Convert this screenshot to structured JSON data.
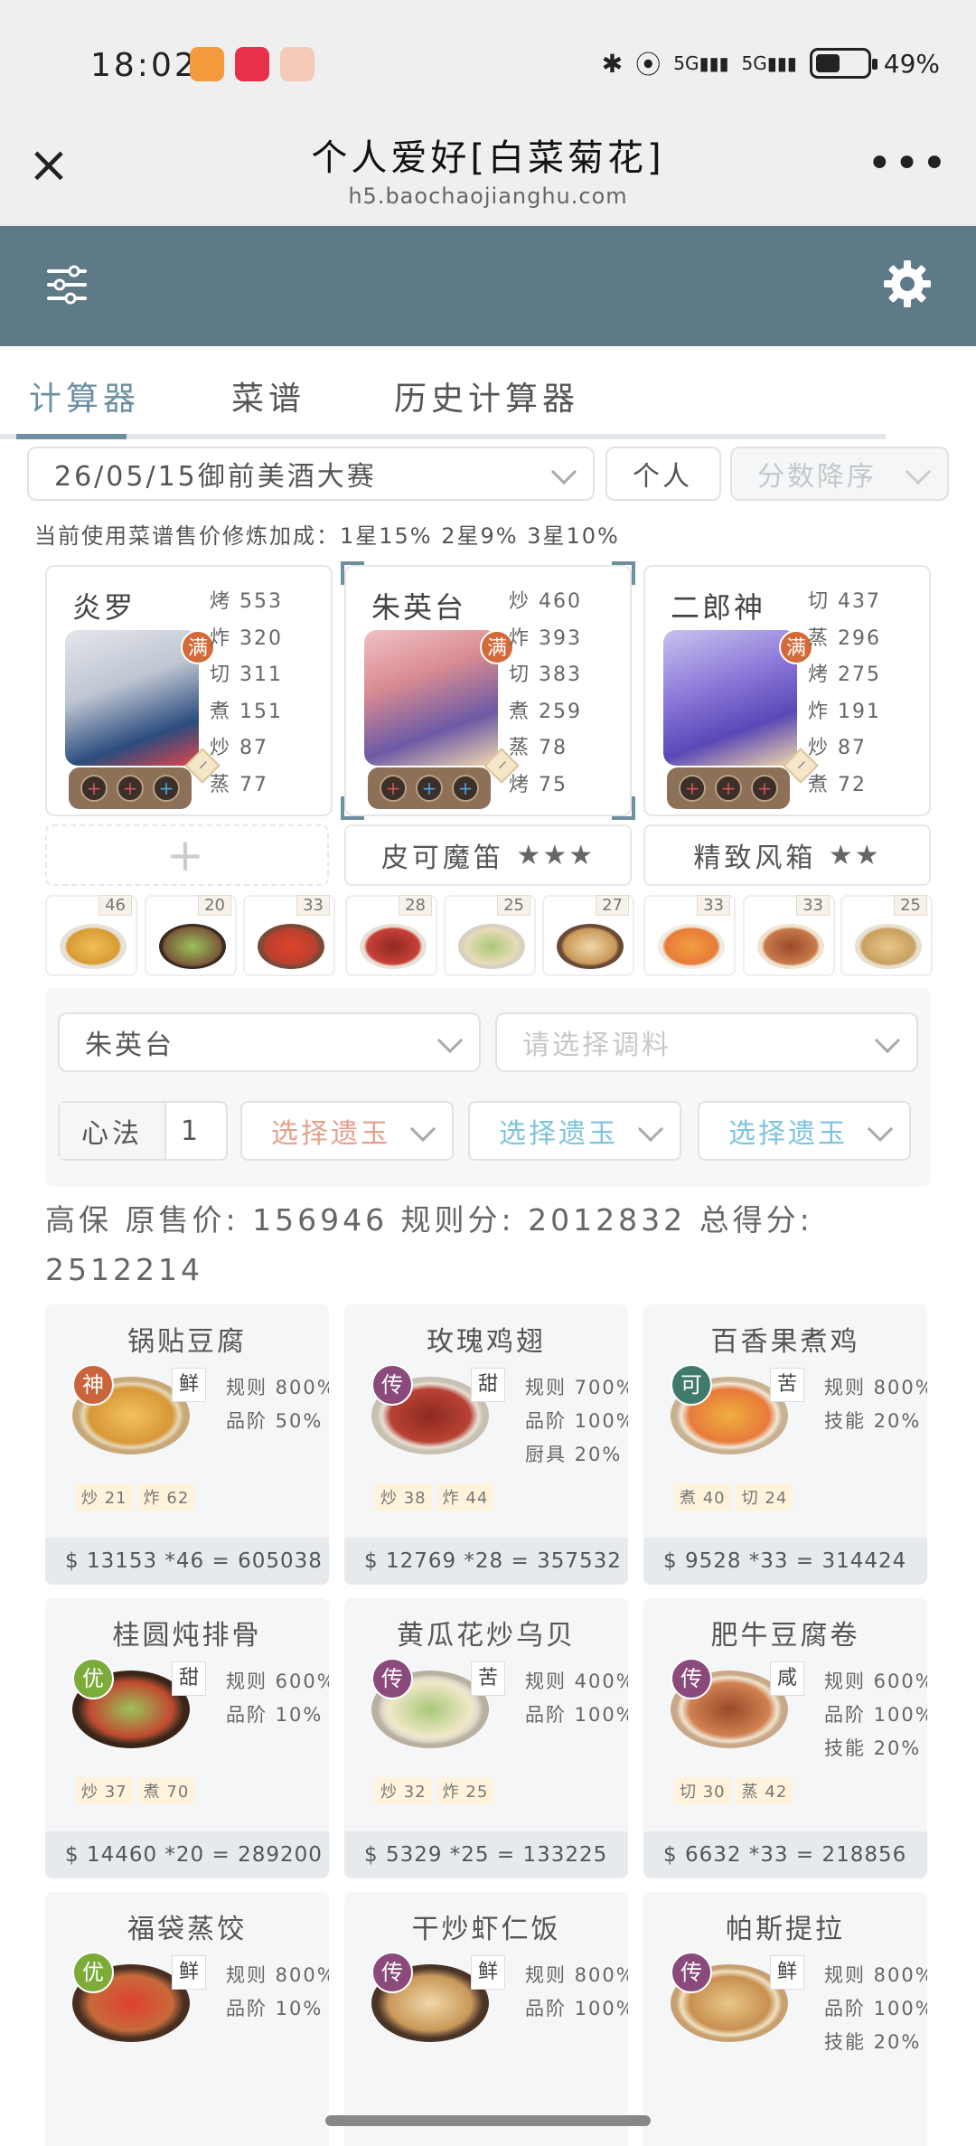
{
  "status_bar": {
    "time": "18:02",
    "battery": "49%",
    "net1": "5G",
    "net2": "5G"
  },
  "browser": {
    "title": "个人爱好[白菜菊花]",
    "url": "h5.baochaojianghu.com",
    "close_icon": "close-icon",
    "more_icon": "more-icon"
  },
  "appbar": {
    "menu_icon": "sliders-icon",
    "settings_icon": "gear-icon",
    "color": "#5e7a87"
  },
  "tabs": [
    {
      "label": "计算器",
      "active": true
    },
    {
      "label": "菜谱",
      "active": false
    },
    {
      "label": "历史计算器",
      "active": false
    }
  ],
  "filters": {
    "contest": "26/05/15御前美酒大赛",
    "mode": "个人",
    "sort": "分数降序"
  },
  "bonus_text": "当前使用菜谱售价修炼加成：1星15% 2星9% 3星10%",
  "chefs": [
    {
      "name": "炎罗",
      "stats": [
        "烤 553",
        "炸 320",
        "切 311",
        "煮 151",
        "炒 87",
        "蒸 77"
      ],
      "badge": "满",
      "slots": [
        "+",
        "+",
        "+"
      ]
    },
    {
      "name": "朱英台",
      "stats": [
        "炒 460",
        "炸 393",
        "切 383",
        "煮 259",
        "蒸 78",
        "烤 75"
      ],
      "badge": "满",
      "slots": [
        "+",
        "+",
        "+"
      ]
    },
    {
      "name": "二郎神",
      "stats": [
        "切 437",
        "蒸 296",
        "烤 275",
        "炸 191",
        "炒 87",
        "煮 72"
      ],
      "badge": "满",
      "slots": [
        "+",
        "+",
        "+"
      ]
    }
  ],
  "equips": [
    {
      "label": "",
      "stars": "",
      "empty": true
    },
    {
      "label": "皮可魔笛",
      "stars": "★★★"
    },
    {
      "label": "精致风箱",
      "stars": "★★"
    }
  ],
  "dishes": [
    {
      "count": "46"
    },
    {
      "count": "20"
    },
    {
      "count": "33"
    },
    {
      "count": "28"
    },
    {
      "count": "25"
    },
    {
      "count": "27"
    },
    {
      "count": "33"
    },
    {
      "count": "33"
    },
    {
      "count": "25"
    }
  ],
  "config": {
    "chef_select": "朱英台",
    "seasoning_placeholder": "请选择调料",
    "heart_label": "心法",
    "heart_value": "1",
    "gems": [
      {
        "label": "选择遗玉",
        "color": "#e8a08c"
      },
      {
        "label": "选择遗玉",
        "color": "#7ec4dc"
      },
      {
        "label": "选择遗玉",
        "color": "#7ec4dc"
      }
    ]
  },
  "summary": "高保 原售价: 156946 规则分: 2012832 总得分: 2512214",
  "recipes": [
    {
      "name": "锅贴豆腐",
      "badge": "神",
      "badge_color": "#c9653c",
      "flavor": "鲜",
      "rules": [
        "规则 800%",
        "品阶 50%"
      ],
      "skills": [
        "炒 21",
        "炸 62"
      ],
      "total": "$ 13153 *46 = 605038"
    },
    {
      "name": "玫瑰鸡翅",
      "badge": "传",
      "badge_color": "#8b4a7c",
      "flavor": "甜",
      "rules": [
        "规则 700%",
        "品阶 100%",
        "厨具 20%"
      ],
      "skills": [
        "炒 38",
        "炸 44"
      ],
      "total": "$ 12769 *28 = 357532"
    },
    {
      "name": "百香果煮鸡",
      "badge": "可",
      "badge_color": "#3f7a6c",
      "flavor": "苦",
      "rules": [
        "规则 800%",
        "技能 20%"
      ],
      "skills": [
        "煮 40",
        "切 24"
      ],
      "total": "$ 9528 *33 = 314424"
    },
    {
      "name": "桂圆炖排骨",
      "badge": "优",
      "badge_color": "#7cab3a",
      "flavor": "甜",
      "rules": [
        "规则 600%",
        "品阶 10%"
      ],
      "skills": [
        "炒 37",
        "煮 70"
      ],
      "total": "$ 14460 *20 = 289200"
    },
    {
      "name": "黄瓜花炒乌贝",
      "badge": "传",
      "badge_color": "#8b4a7c",
      "flavor": "苦",
      "rules": [
        "规则 400%",
        "品阶 100%"
      ],
      "skills": [
        "炒 32",
        "炸 25"
      ],
      "total": "$ 5329 *25 = 133225"
    },
    {
      "name": "肥牛豆腐卷",
      "badge": "传",
      "badge_color": "#8b4a7c",
      "flavor": "咸",
      "rules": [
        "规则 600%",
        "品阶 100%",
        "技能 20%"
      ],
      "skills": [
        "切 30",
        "蒸 42"
      ],
      "total": "$ 6632 *33 = 218856"
    },
    {
      "name": "福袋蒸饺",
      "badge": "优",
      "badge_color": "#7cab3a",
      "flavor": "鲜",
      "rules": [
        "规则 800%",
        "品阶 10%"
      ],
      "skills": [],
      "total": ""
    },
    {
      "name": "干炒虾仁饭",
      "badge": "传",
      "badge_color": "#8b4a7c",
      "flavor": "鲜",
      "rules": [
        "规则 800%",
        "品阶 100%"
      ],
      "skills": [],
      "total": ""
    },
    {
      "name": "帕斯提拉",
      "badge": "传",
      "badge_color": "#8b4a7c",
      "flavor": "鲜",
      "rules": [
        "规则 800%",
        "品阶 100%",
        "技能 20%"
      ],
      "skills": [],
      "total": ""
    }
  ]
}
